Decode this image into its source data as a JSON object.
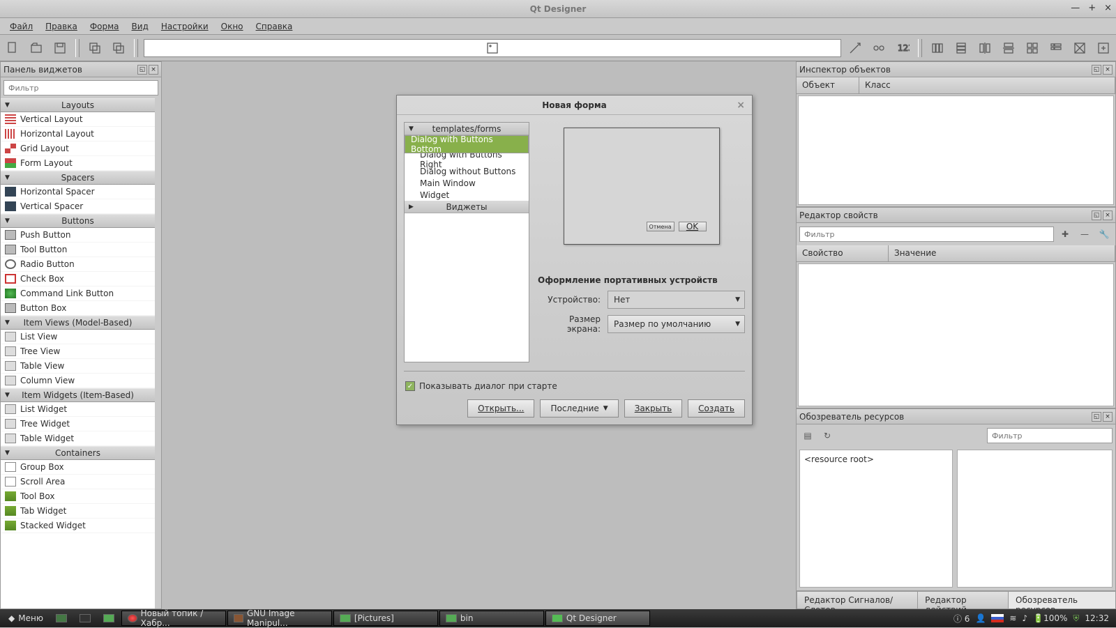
{
  "window": {
    "title": "Qt Designer"
  },
  "menu": [
    "Файл",
    "Правка",
    "Форма",
    "Вид",
    "Настройки",
    "Окно",
    "Справка"
  ],
  "widgetbox": {
    "title": "Панель виджетов",
    "filter_placeholder": "Фильтр",
    "cats": [
      {
        "name": "Layouts",
        "items": [
          "Vertical Layout",
          "Horizontal Layout",
          "Grid Layout",
          "Form Layout"
        ]
      },
      {
        "name": "Spacers",
        "items": [
          "Horizontal Spacer",
          "Vertical Spacer"
        ]
      },
      {
        "name": "Buttons",
        "items": [
          "Push Button",
          "Tool Button",
          "Radio Button",
          "Check Box",
          "Command Link Button",
          "Button Box"
        ]
      },
      {
        "name": "Item Views (Model-Based)",
        "items": [
          "List View",
          "Tree View",
          "Table View",
          "Column View"
        ]
      },
      {
        "name": "Item Widgets (Item-Based)",
        "items": [
          "List Widget",
          "Tree Widget",
          "Table Widget"
        ]
      },
      {
        "name": "Containers",
        "items": [
          "Group Box",
          "Scroll Area",
          "Tool Box",
          "Tab Widget",
          "Stacked Widget"
        ]
      }
    ]
  },
  "dialog": {
    "title": "Новая форма",
    "tree_hdr1": "templates/forms",
    "tree_hdr2": "Виджеты",
    "templates": [
      "Dialog with Buttons Bottom",
      "Dialog with Buttons Right",
      "Dialog without Buttons",
      "Main Window",
      "Widget"
    ],
    "preview_cancel": "Отмена",
    "preview_ok": "OK",
    "section": "Оформление портативных устройств",
    "device_label": "Устройство:",
    "device_value": "Нет",
    "size_label": "Размер экрана:",
    "size_value": "Размер по умолчанию",
    "show_startup": "Показывать диалог при старте",
    "btn_open": "Открыть...",
    "btn_recent": "Последние",
    "btn_close": "Закрыть",
    "btn_create": "Создать"
  },
  "inspector": {
    "title": "Инспектор объектов",
    "col_obj": "Объект",
    "col_cls": "Класс"
  },
  "propeditor": {
    "title": "Редактор свойств",
    "filter_placeholder": "Фильтр",
    "col_prop": "Свойство",
    "col_val": "Значение"
  },
  "resources": {
    "title": "Обозреватель ресурсов",
    "filter_placeholder": "Фильтр",
    "root": "<resource root>",
    "tab_signals": "Редактор Сигналов/Слотов",
    "tab_actions": "Редактор действий",
    "tab_res": "Обозреватель ресурсов"
  },
  "taskbar": {
    "menu": "Меню",
    "apps": [
      "Новый топик / Хабр...",
      "GNU Image Manipul...",
      "[Pictures]",
      "bin",
      "Qt Designer"
    ],
    "notif_count": "6",
    "battery": "100%",
    "time": "12:32"
  }
}
